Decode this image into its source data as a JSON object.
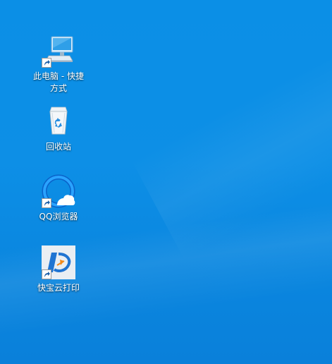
{
  "desktop": {
    "icons": [
      {
        "label": "此电脑 - 快捷方式",
        "icon": "computer-icon",
        "shortcut": true
      },
      {
        "label": "回收站",
        "icon": "recycle-bin-icon",
        "shortcut": false
      },
      {
        "label": "QQ浏览器",
        "icon": "qq-browser-icon",
        "shortcut": true
      },
      {
        "label": "快宝云打印",
        "icon": "kuaibao-print-icon",
        "shortcut": true
      }
    ]
  },
  "colors": {
    "desktop_background": "#0b8fe6",
    "label_text": "#ffffff"
  }
}
